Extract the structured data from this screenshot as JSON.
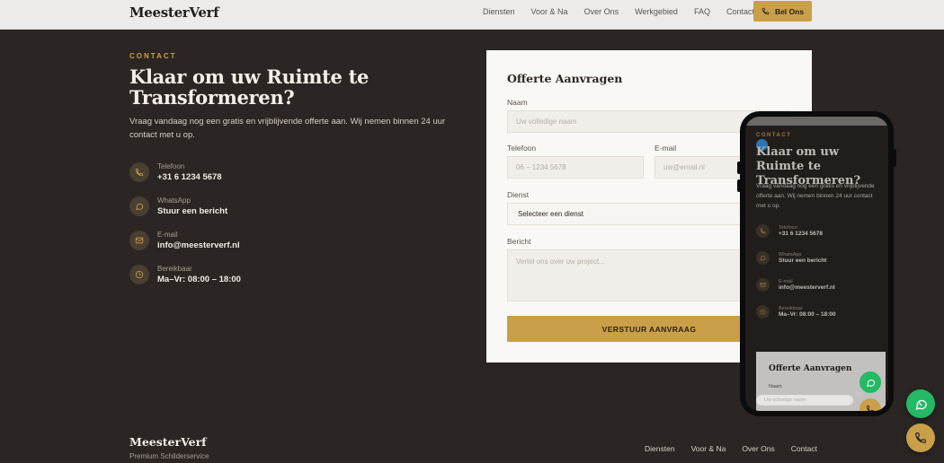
{
  "header": {
    "logo": "MeesterVerf",
    "nav": [
      "Diensten",
      "Voor & Na",
      "Over Ons",
      "Werkgebied",
      "FAQ",
      "Contact"
    ],
    "call_button": "Bel Ons"
  },
  "contact": {
    "eyebrow": "CONTACT",
    "headline_line1": "Klaar om uw Ruimte te",
    "headline_line2": "Transformeren?",
    "lead": "Vraag vandaag nog een gratis en vrijblijvende offerte aan. Wij nemen binnen 24 uur contact met u op.",
    "items": [
      {
        "label": "Telefoon",
        "value": "+31 6 1234 5678",
        "icon": "phone-icon"
      },
      {
        "label": "WhatsApp",
        "value": "Stuur een bericht",
        "icon": "chat-icon"
      },
      {
        "label": "E-mail",
        "value": "info@meesterverf.nl",
        "icon": "mail-icon"
      },
      {
        "label": "Bereikbaar",
        "value": "Ma–Vr: 08:00 – 18:00",
        "icon": "clock-icon"
      }
    ]
  },
  "form": {
    "title": "Offerte Aanvragen",
    "name_label": "Naam",
    "name_placeholder": "Uw volledige naam",
    "phone_label": "Telefoon",
    "phone_placeholder": "06 – 1234 5678",
    "email_label": "E-mail",
    "email_placeholder": "uw@email.nl",
    "service_label": "Dienst",
    "service_value": "Selecteer een dienst",
    "message_label": "Bericht",
    "message_placeholder": "Vertel ons over uw project...",
    "submit": "VERSTUUR AANVRAAG"
  },
  "phone_preview": {
    "eyebrow": "CONTACT",
    "headline_line1": "Klaar om uw Ruimte te",
    "headline_line2": "Transformeren?",
    "lead": "Vraag vandaag nog een gratis en vrijblijvende offerte aan. Wij nemen binnen 24 uur contact met u op.",
    "form_title": "Offerte Aanvragen",
    "name_label": "Naam",
    "name_placeholder": "Uw volledige naam"
  },
  "footer": {
    "logo": "MeesterVerf",
    "tagline": "Premium Schilderservice",
    "nav": [
      "Diensten",
      "Voor & Na",
      "Over Ons",
      "Contact"
    ]
  },
  "colors": {
    "accent": "#c9a049",
    "background": "#2b2623",
    "whatsapp": "#25b865"
  }
}
